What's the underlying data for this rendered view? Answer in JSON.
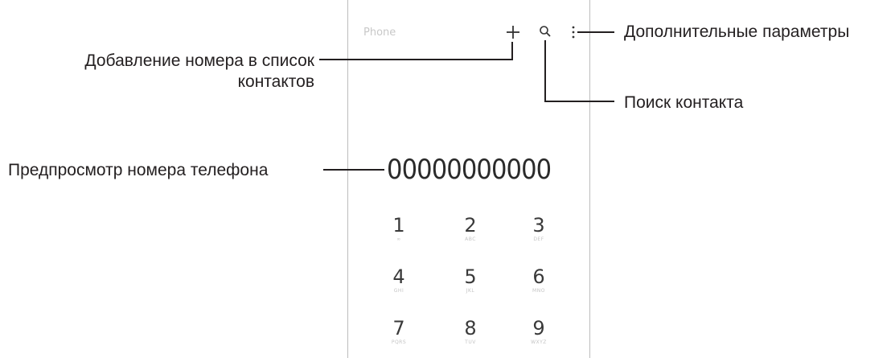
{
  "app": {
    "title": "Phone"
  },
  "header": {
    "add_icon": "plus-icon",
    "search_icon": "search-icon",
    "more_icon": "more-vertical-icon"
  },
  "number_preview": "00000000000",
  "keypad": [
    {
      "digit": "1",
      "letters": "∞"
    },
    {
      "digit": "2",
      "letters": "ABC"
    },
    {
      "digit": "3",
      "letters": "DEF"
    },
    {
      "digit": "4",
      "letters": "GHI"
    },
    {
      "digit": "5",
      "letters": "JKL"
    },
    {
      "digit": "6",
      "letters": "MNO"
    },
    {
      "digit": "7",
      "letters": "PQRS"
    },
    {
      "digit": "8",
      "letters": "TUV"
    },
    {
      "digit": "9",
      "letters": "WXYZ"
    }
  ],
  "callouts": {
    "add_contact": {
      "line1": "Добавление номера в список",
      "line2": "контактов"
    },
    "number_preview": "Предпросмотр номера телефона",
    "more_options": "Дополнительные параметры",
    "search_contact": "Поиск контакта"
  }
}
